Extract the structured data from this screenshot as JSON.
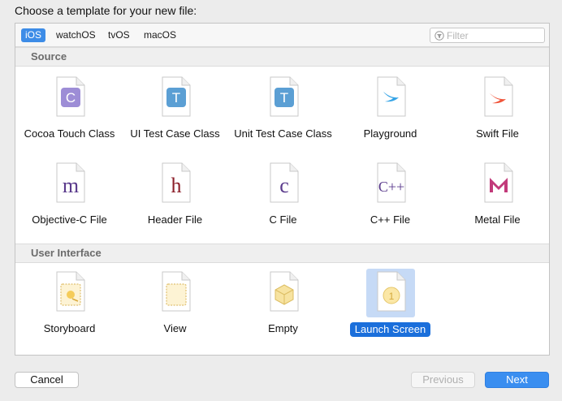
{
  "dialog": {
    "prompt": "Choose a template for your new file:"
  },
  "tabs": [
    {
      "label": "iOS",
      "active": true
    },
    {
      "label": "watchOS",
      "active": false
    },
    {
      "label": "tvOS",
      "active": false
    },
    {
      "label": "macOS",
      "active": false
    }
  ],
  "filter": {
    "placeholder": "Filter",
    "value": ""
  },
  "sections": [
    {
      "title": "Source",
      "items": [
        {
          "label": "Cocoa Touch Class",
          "icon": "cocoa-touch-class-icon",
          "glyph": "C"
        },
        {
          "label": "UI Test Case Class",
          "icon": "ui-test-case-class-icon",
          "glyph": "T"
        },
        {
          "label": "Unit Test Case Class",
          "icon": "unit-test-case-class-icon",
          "glyph": "T"
        },
        {
          "label": "Playground",
          "icon": "playground-icon",
          "glyph": ""
        },
        {
          "label": "Swift File",
          "icon": "swift-file-icon",
          "glyph": ""
        },
        {
          "label": "Objective-C File",
          "icon": "objective-c-file-icon",
          "glyph": "m"
        },
        {
          "label": "Header File",
          "icon": "header-file-icon",
          "glyph": "h"
        },
        {
          "label": "C File",
          "icon": "c-file-icon",
          "glyph": "c"
        },
        {
          "label": "C++ File",
          "icon": "cpp-file-icon",
          "glyph": "C++"
        },
        {
          "label": "Metal File",
          "icon": "metal-file-icon",
          "glyph": "M"
        }
      ]
    },
    {
      "title": "User Interface",
      "items": [
        {
          "label": "Storyboard",
          "icon": "storyboard-icon",
          "glyph": ""
        },
        {
          "label": "View",
          "icon": "view-file-icon",
          "glyph": ""
        },
        {
          "label": "Empty",
          "icon": "empty-file-icon",
          "glyph": ""
        },
        {
          "label": "Launch Screen",
          "icon": "launch-screen-icon",
          "glyph": "1",
          "selected": true
        }
      ]
    }
  ],
  "buttons": {
    "cancel": "Cancel",
    "previous": "Previous",
    "next": "Next"
  },
  "colors": {
    "accent": "#3d8ce7",
    "selection": "#1b6fdb",
    "objc_purple": "#5a3a8c",
    "header_red": "#8c1f2a",
    "test_blue": "#4b8fc8",
    "swift_orange": "#f0553a",
    "playground_blue": "#33a3e6"
  }
}
